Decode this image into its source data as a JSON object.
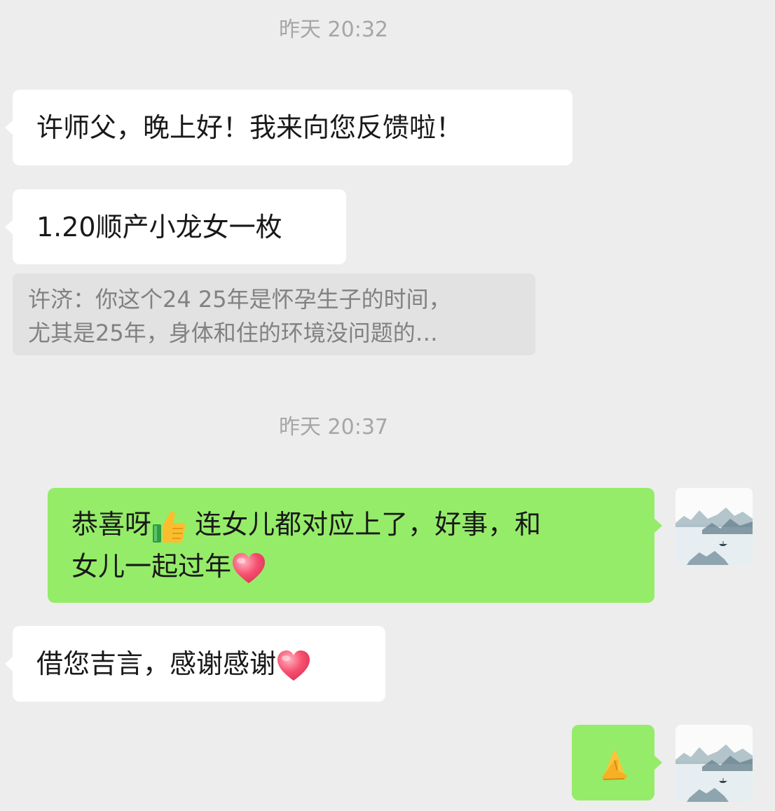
{
  "timestamps": [
    "昨天 20:32",
    "昨天 20:37"
  ],
  "messages": [
    {
      "side": "left",
      "text": "许师父，晚上好！我来向您反馈啦！"
    },
    {
      "side": "left",
      "text": "1.20顺产小龙女一枚"
    },
    {
      "side": "left",
      "text": "借您吉言，感谢感谢",
      "emoji": "heart-emoji"
    }
  ],
  "quote": {
    "line1": "许济：你这个24 25年是怀孕生子的时间，",
    "line2": "尤其是25年，身体和住的环境没问题的…"
  },
  "replies": [
    {
      "side": "right",
      "part1": "恭喜呀",
      "emoji1": "thumbs-up-emoji",
      "part2": " 连女儿都对应上了，好事，和",
      "part3": "女儿一起过年",
      "emoji2": "heart-emoji"
    },
    {
      "side": "right",
      "emoji": "folded-hands-emoji"
    }
  ],
  "avatar": {
    "name": "landscape-avatar",
    "style": "ink mountains and lake"
  },
  "colors": {
    "background": "#ededed",
    "incoming": "#ffffff",
    "outgoing": "#95ec69",
    "quote": "#e2e2e2",
    "timestamp": "#a6a6a6"
  }
}
